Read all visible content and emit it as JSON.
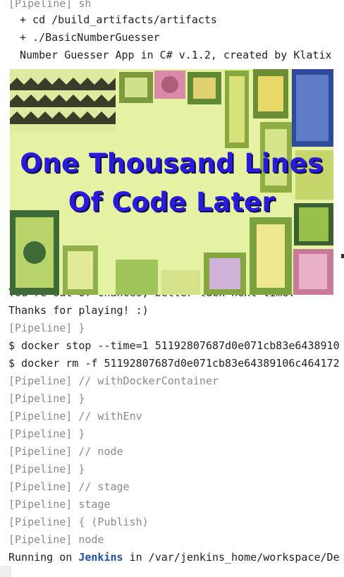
{
  "console": {
    "lines_top": [
      {
        "text": "[Pipeline] sh",
        "style": "muted"
      },
      {
        "text": "+ cd /build_artifacts/artifacts",
        "style": "indent"
      },
      {
        "text": "+ ./BasicNumberGuesser",
        "style": "indent"
      },
      {
        "text": "Number Guesser App in C# v.1.2, created by Klatix",
        "style": "indent"
      }
    ],
    "partial_line": "You're out of chances, better luck next time.",
    "lines_bottom": [
      {
        "text": "Thanks for playing! :)",
        "style": "plain"
      },
      {
        "text": "[Pipeline] }",
        "style": "muted"
      },
      {
        "text": "$ docker stop --time=1 51192807687d0e071cb83e6438910",
        "style": "plain"
      },
      {
        "text": "$ docker rm -f 51192807687d0e071cb83e64389106c464172",
        "style": "plain"
      },
      {
        "text": "[Pipeline] // withDockerContainer",
        "style": "muted"
      },
      {
        "text": "[Pipeline] }",
        "style": "muted"
      },
      {
        "text": "[Pipeline] // withEnv",
        "style": "muted"
      },
      {
        "text": "[Pipeline] }",
        "style": "muted"
      },
      {
        "text": "[Pipeline] // node",
        "style": "muted"
      },
      {
        "text": "[Pipeline] }",
        "style": "muted"
      },
      {
        "text": "[Pipeline] // stage",
        "style": "muted"
      },
      {
        "text": "[Pipeline] stage",
        "style": "muted"
      },
      {
        "text": "[Pipeline] { (Publish)",
        "style": "muted"
      },
      {
        "text": "[Pipeline] node",
        "style": "muted"
      }
    ],
    "running_line": {
      "prefix": "Running on ",
      "link": "Jenkins",
      "suffix": " in /var/jenkins_home/workspace/De"
    }
  },
  "meme": {
    "caption_line1": "One Thousand Lines",
    "caption_line2": "Of Code Later"
  },
  "colors": {
    "link": "#1f4fa0",
    "caption": "#2a1adb",
    "muted": "#8a8a8a"
  }
}
